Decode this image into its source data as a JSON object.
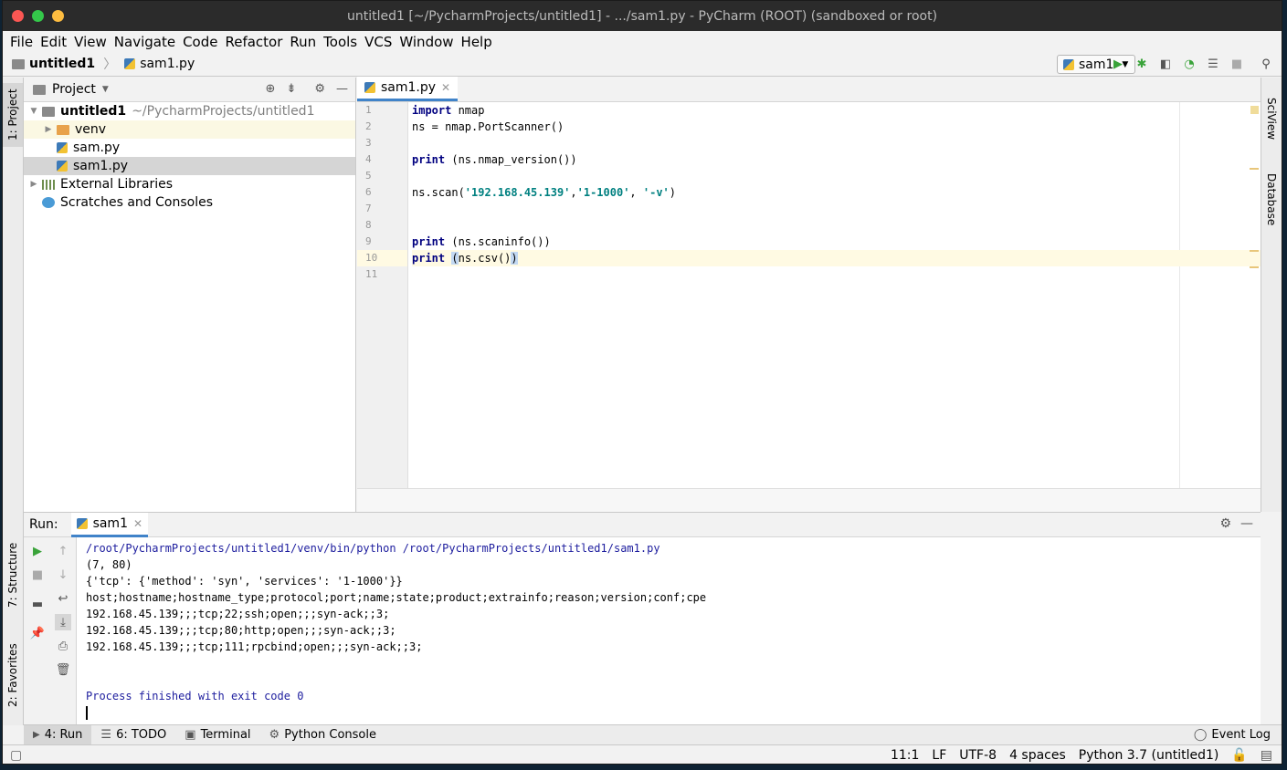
{
  "window": {
    "title": "untitled1 [~/PycharmProjects/untitled1] - .../sam1.py - PyCharm (ROOT) (sandboxed or root)"
  },
  "menu": [
    "File",
    "Edit",
    "View",
    "Navigate",
    "Code",
    "Refactor",
    "Run",
    "Tools",
    "VCS",
    "Window",
    "Help"
  ],
  "nav": {
    "project": "untitled1",
    "file": "sam1.py",
    "run_config": "sam1"
  },
  "left_tabs": {
    "project": "1: Project",
    "structure": "7: Structure",
    "favorites": "2: Favorites"
  },
  "right_tabs": {
    "sciview": "SciView",
    "database": "Database"
  },
  "project_panel": {
    "title": "Project",
    "root_name": "untitled1",
    "root_path": "~/PycharmProjects/untitled1",
    "venv": "venv",
    "file1": "sam.py",
    "file2": "sam1.py",
    "external": "External Libraries",
    "scratches": "Scratches and Consoles"
  },
  "editor": {
    "tab": "sam1.py",
    "line_numbers": [
      "1",
      "2",
      "3",
      "4",
      "5",
      "6",
      "7",
      "8",
      "9",
      "10",
      "11"
    ],
    "code": {
      "l1_kw": "import",
      "l1_rest": " nmap",
      "l2": "ns = nmap.PortScanner()",
      "l4_kw": "print",
      "l4_rest": " (ns.nmap_version())",
      "l6_a": "ns.scan(",
      "l6_s1": "'192.168.45.139'",
      "l6_b": ",",
      "l6_s2": "'1-1000'",
      "l6_c": ", ",
      "l6_s3": "'-v'",
      "l6_d": ")",
      "l9_kw": "print",
      "l9_rest": " (ns.scaninfo())",
      "l10_kw": "print",
      "l10_a": " ",
      "l10_p1": "(",
      "l10_mid": "ns.csv()",
      "l10_p2": ")"
    }
  },
  "run": {
    "label": "Run:",
    "tab": "sam1",
    "output": [
      "/root/PycharmProjects/untitled1/venv/bin/python /root/PycharmProjects/untitled1/sam1.py",
      "(7, 80)",
      "{'tcp': {'method': 'syn', 'services': '1-1000'}}",
      "host;hostname;hostname_type;protocol;port;name;state;product;extrainfo;reason;version;conf;cpe",
      "192.168.45.139;;;tcp;22;ssh;open;;;syn-ack;;3;",
      "192.168.45.139;;;tcp;80;http;open;;;syn-ack;;3;",
      "192.168.45.139;;;tcp;111;rpcbind;open;;;syn-ack;;3;",
      "",
      "",
      "Process finished with exit code 0"
    ]
  },
  "tool_tabs": {
    "run": "4: Run",
    "todo": "6: TODO",
    "terminal": "Terminal",
    "python_console": "Python Console",
    "event_log": "Event Log"
  },
  "status": {
    "position": "11:1",
    "line_sep": "LF",
    "encoding": "UTF-8",
    "indent": "4 spaces",
    "interpreter": "Python 3.7 (untitled1)"
  },
  "colors": {
    "accent": "#4083c9",
    "keyword": "#000080",
    "string": "#008080",
    "run_green": "#3aa33a"
  }
}
